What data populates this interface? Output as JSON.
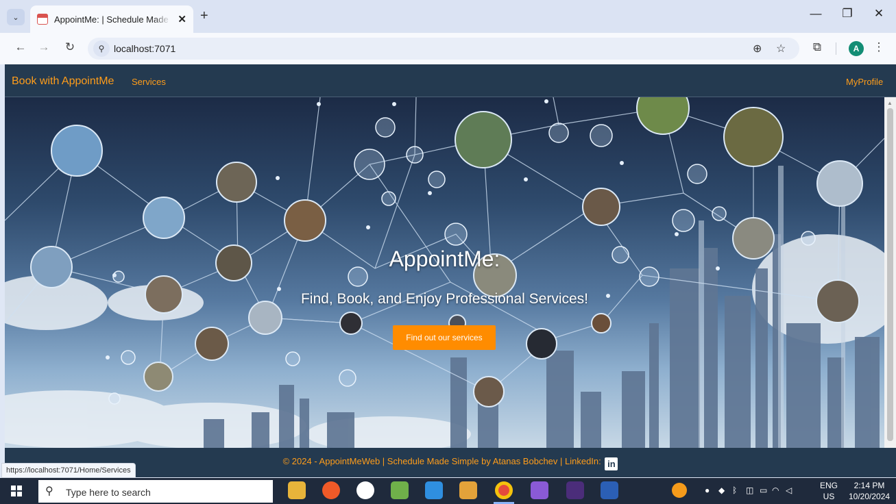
{
  "browser": {
    "tab_title": "AppointMe: | Schedule Made Si",
    "tab_close": "✕",
    "new_tab": "+",
    "url": "localhost:7071",
    "profile_initial": "A",
    "status_url": "https://localhost:7071/Home/Services"
  },
  "site": {
    "brand": "Book with AppointMe",
    "nav": {
      "services": "Services",
      "profile": "MyProfile"
    },
    "hero": {
      "title": "AppointMe:",
      "subtitle": "Find, Book, and Enjoy Professional Services!",
      "cta": "Find out our services"
    },
    "footer": {
      "text": "© 2024 - AppointMeWeb | Schedule Made Simple by Atanas Bobchev | LinkedIn:",
      "linkedin_icon": "in"
    }
  },
  "taskbar": {
    "search_placeholder": "Type here to search",
    "language": "ENG",
    "region": "US",
    "time": "2:14 PM",
    "date": "10/20/2024",
    "pinned_apps": [
      "file-explorer-icon",
      "brave-icon",
      "mongodb-compass-icon",
      "notepad-icon",
      "vscode-icon",
      "paint-icon",
      "chrome-icon",
      "visual-studio-icon",
      "terminal-icon",
      "word-icon"
    ]
  },
  "colors": {
    "accent": "#ff9d1a",
    "cta_bg": "#ff8c00",
    "site_nav_bg": "#243a50"
  }
}
